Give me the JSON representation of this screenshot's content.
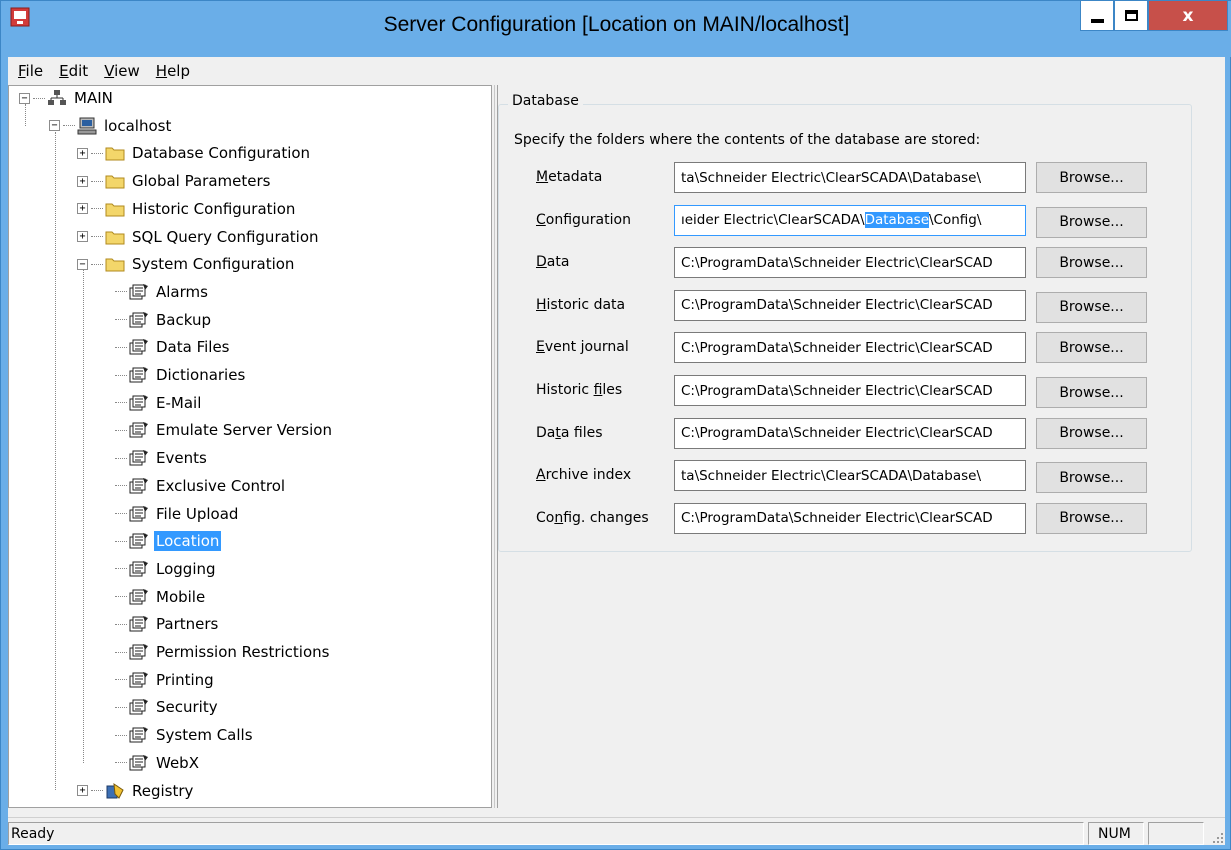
{
  "window": {
    "title": "Server Configuration [Location on MAIN/localhost]",
    "close_glyph": "x",
    "accent_color": "#6aaee8",
    "close_color": "#c7504a"
  },
  "menu": [
    {
      "label": "File",
      "mnemonic": "F",
      "rest": "ile"
    },
    {
      "label": "Edit",
      "mnemonic": "E",
      "rest": "dit"
    },
    {
      "label": "View",
      "mnemonic": "V",
      "rest": "iew"
    },
    {
      "label": "Help",
      "mnemonic": "H",
      "rest": "elp"
    }
  ],
  "tree": {
    "root": {
      "label": "MAIN",
      "expander": "−",
      "icon": "network-icon"
    },
    "server": {
      "label": "localhost",
      "expander": "−",
      "icon": "computer-icon"
    },
    "folders": [
      {
        "label": "Database Configuration",
        "expander": "+"
      },
      {
        "label": "Global Parameters",
        "expander": "+"
      },
      {
        "label": "Historic Configuration",
        "expander": "+"
      },
      {
        "label": "SQL Query Configuration",
        "expander": "+"
      },
      {
        "label": "System Configuration",
        "expander": "−"
      }
    ],
    "system_items": [
      {
        "label": "Alarms"
      },
      {
        "label": "Backup"
      },
      {
        "label": "Data Files"
      },
      {
        "label": "Dictionaries"
      },
      {
        "label": "E-Mail"
      },
      {
        "label": "Emulate Server Version"
      },
      {
        "label": "Events"
      },
      {
        "label": "Exclusive Control"
      },
      {
        "label": "File Upload"
      },
      {
        "label": "Location",
        "selected": true
      },
      {
        "label": "Logging"
      },
      {
        "label": "Mobile"
      },
      {
        "label": "Partners"
      },
      {
        "label": "Permission Restrictions"
      },
      {
        "label": "Printing"
      },
      {
        "label": "Security"
      },
      {
        "label": "System Calls"
      },
      {
        "label": "WebX"
      }
    ],
    "registry": {
      "label": "Registry",
      "expander": "+",
      "icon": "registry-icon"
    }
  },
  "database": {
    "group_title": "Database",
    "description": "Specify the folders where the contents of the database are stored:",
    "browse_label": "Browse...",
    "fields": [
      {
        "label": "Metadata",
        "mnemonic": "M",
        "rest": "etadata",
        "value": "ta\\Schneider Electric\\ClearSCADA\\Database\\"
      },
      {
        "label": "Configuration",
        "mnemonic": "C",
        "rest": "onfiguration",
        "value_before": "ıeider Electric\\ClearSCADA\\",
        "value_selected": "Database",
        "value_after": "\\Config\\"
      },
      {
        "label": "Data",
        "mnemonic": "D",
        "rest": "ata",
        "value": "C:\\ProgramData\\Schneider Electric\\ClearSCAD"
      },
      {
        "label": "Historic data",
        "mnemonic": "H",
        "rest": "istoric data",
        "value": "C:\\ProgramData\\Schneider Electric\\ClearSCAD"
      },
      {
        "label": "Event journal",
        "mnemonic": "E",
        "rest": "vent journal",
        "value": "C:\\ProgramData\\Schneider Electric\\ClearSCAD"
      },
      {
        "label": "Historic files",
        "pre": "Historic ",
        "mnemonic": "f",
        "rest": "iles",
        "value": "C:\\ProgramData\\Schneider Electric\\ClearSCAD"
      },
      {
        "label": "Data files",
        "pre": "Da",
        "mnemonic": "t",
        "rest": "a files",
        "value": "C:\\ProgramData\\Schneider Electric\\ClearSCAD"
      },
      {
        "label": "Archive index",
        "mnemonic": "A",
        "rest": "rchive index",
        "value": "ta\\Schneider Electric\\ClearSCADA\\Database\\"
      },
      {
        "label": "Config. changes",
        "pre": "Co",
        "mnemonic": "n",
        "rest": "fig. changes",
        "value": "C:\\ProgramData\\Schneider Electric\\ClearSCAD"
      }
    ]
  },
  "status": {
    "text": "Ready",
    "num": "NUM"
  }
}
